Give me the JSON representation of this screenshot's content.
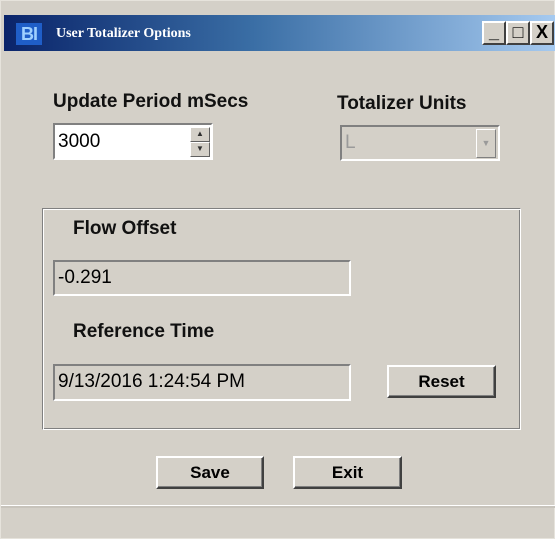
{
  "window": {
    "title": "User Totalizer Options",
    "icon_label": "BI",
    "title_bar_color": "#0a246a",
    "controls": {
      "minimize": "_",
      "maximize": "□",
      "close": "X"
    }
  },
  "update_period": {
    "label": "Update Period mSecs",
    "value": "3000",
    "up_glyph": "▲",
    "down_glyph": "▼"
  },
  "totalizer_units": {
    "label": "Totalizer Units",
    "value": "L",
    "arrow_glyph": "▼"
  },
  "flow_offset": {
    "label": "Flow Offset",
    "value": "-0.291"
  },
  "reference_time": {
    "label": "Reference Time",
    "value": "9/13/2016 1:24:54 PM"
  },
  "buttons": {
    "reset": "Reset",
    "save": "Save",
    "exit": "Exit"
  }
}
